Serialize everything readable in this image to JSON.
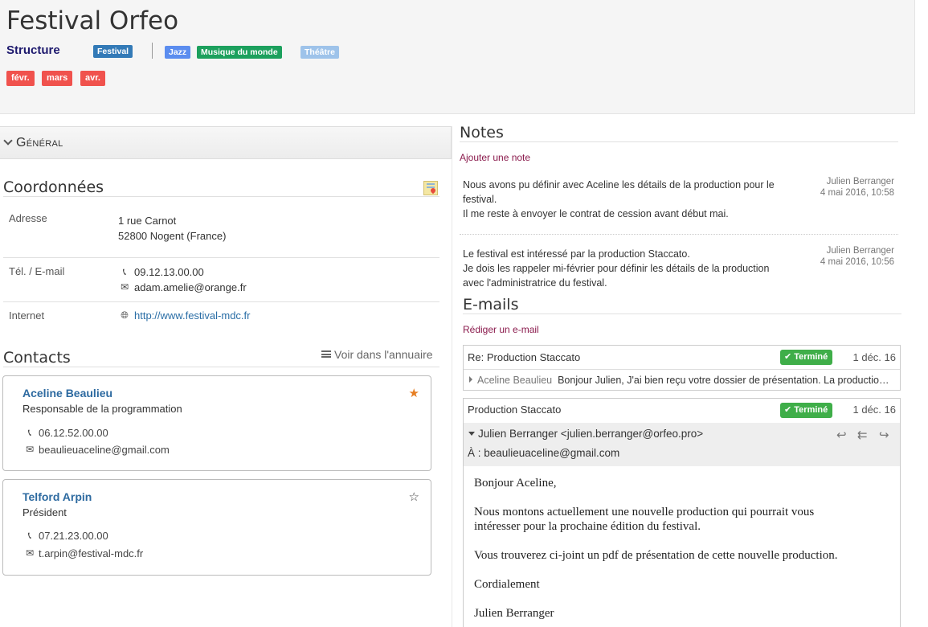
{
  "header": {
    "title": "Festival Orfeo",
    "structure_label": "Structure",
    "type_tag": "Festival",
    "genre_tags": [
      "Jazz",
      "Musique du monde",
      "Théâtre"
    ],
    "months": [
      "févr.",
      "mars",
      "avr."
    ]
  },
  "general": {
    "label": "Général"
  },
  "coordonnees": {
    "title": "Coordonnées",
    "adresse_label": "Adresse",
    "adresse_line1": "1 rue Carnot",
    "adresse_line2": "52800 Nogent (France)",
    "tel_label": "Tél. / E-mail",
    "tel": "09.12.13.00.00",
    "email": "adam.amelie@orange.fr",
    "internet_label": "Internet",
    "website": "http://www.festival-mdc.fr"
  },
  "contacts": {
    "title": "Contacts",
    "directory_link": "Voir dans l'annuaire",
    "items": [
      {
        "name": "Aceline Beaulieu",
        "role": "Responsable de la programmation",
        "phone": "06.12.52.00.00",
        "email": "beaulieuaceline@gmail.com",
        "starred": true
      },
      {
        "name": "Telford Arpin",
        "role": "Président",
        "phone": "07.21.23.00.00",
        "email": "t.arpin@festival-mdc.fr",
        "starred": false
      }
    ]
  },
  "notes": {
    "title": "Notes",
    "add_link": "Ajouter une note",
    "items": [
      {
        "line1": "Nous avons pu définir avec Aceline les détails de la production pour le",
        "line2": "festival.",
        "line3": "Il me reste à envoyer le contrat de cession avant début mai.",
        "author": "Julien Berranger",
        "date": "4 mai 2016, 10:58"
      },
      {
        "line1": "Le festival est intéressé par la production Staccato.",
        "line2": "Je dois les rappeler mi-février pour définir les détails de la production",
        "line3": "avec l'administratrice du festival.",
        "author": "Julien Berranger",
        "date": "4 mai 2016, 10:56"
      }
    ]
  },
  "emails": {
    "title": "E-mails",
    "compose_link": "Rédiger un e-mail",
    "items": [
      {
        "subject": "Re: Production Staccato",
        "status": "Terminé",
        "date": "1 déc. 16",
        "preview_name": "Aceline Beaulieu",
        "preview_text": "Bonjour Julien,  J'ai bien reçu votre dossier de présentation. La production m'intéresse beaucoup"
      },
      {
        "subject": "Production Staccato",
        "status": "Terminé",
        "date": "1 déc. 16",
        "from": "Julien Berranger <julien.berranger@orfeo.pro>",
        "to": "À : beaulieuaceline@gmail.com",
        "body": [
          "Bonjour Aceline,",
          "Nous montons actuellement une nouvelle production qui pourrait vous",
          "intéresser pour la prochaine édition du festival.",
          "Vous trouverez ci-joint un pdf de présentation de cette nouvelle production.",
          "Cordialement",
          "Julien Berranger"
        ]
      }
    ]
  },
  "colors": {
    "accent": "#337ab7",
    "month_tag": "#f0524d",
    "success": "#3fae49",
    "link_purple": "#8a1a4c",
    "star": "#e67e22"
  },
  "icons": {
    "phone": "phone-icon",
    "email": "envelope-icon",
    "globe": "globe-icon",
    "map": "map-icon",
    "list": "list-icon",
    "reply": "reply-icon",
    "reply_all": "reply-all-icon",
    "forward": "forward-icon"
  }
}
